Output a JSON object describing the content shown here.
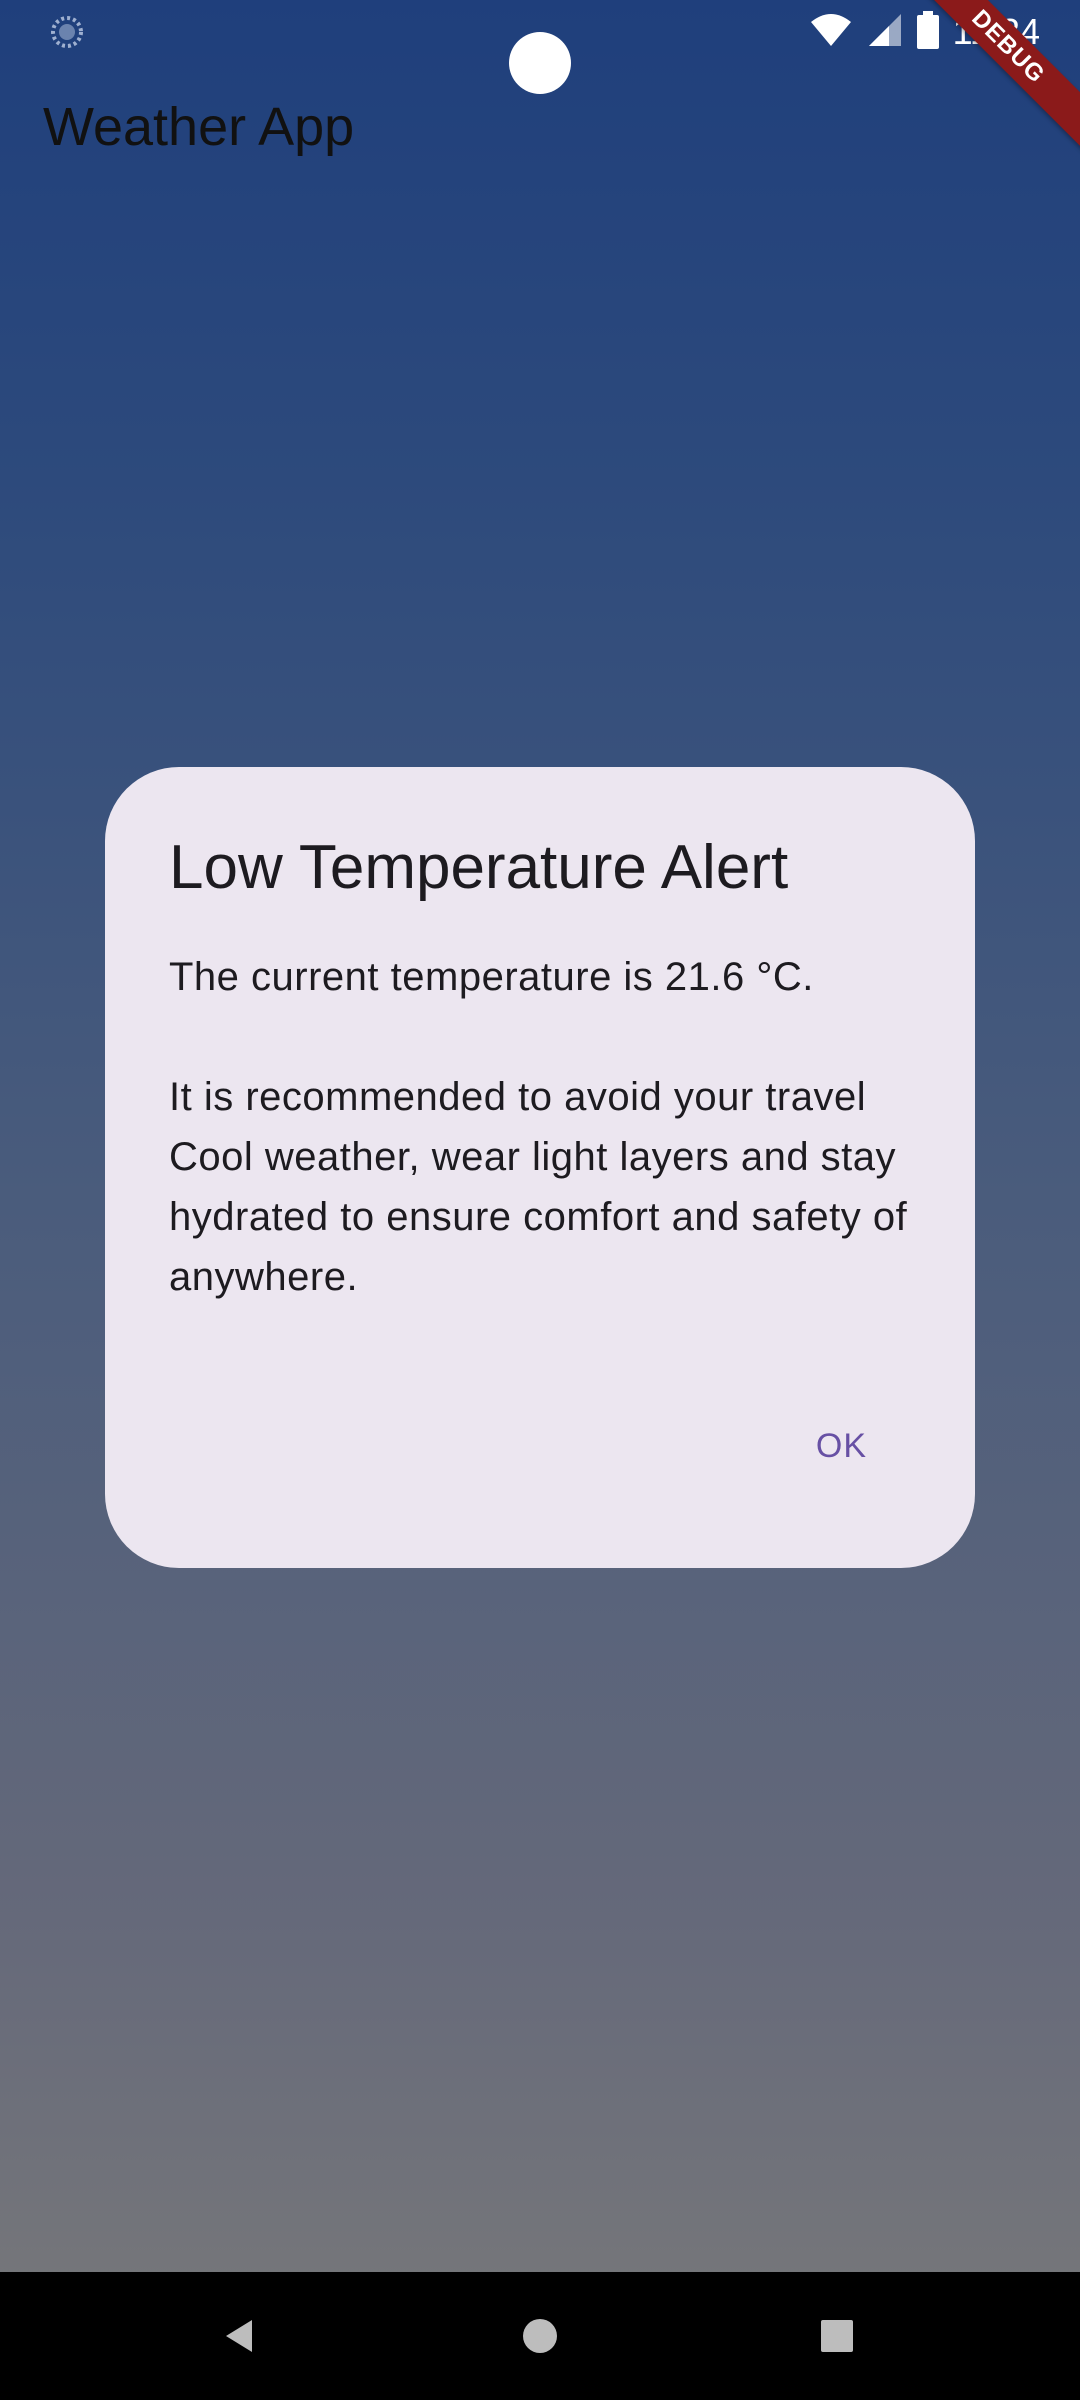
{
  "status_bar": {
    "time": "11:34",
    "left_icon": "loading-spinner-icon",
    "icons": [
      "wifi-icon",
      "signal-icon",
      "battery-icon"
    ]
  },
  "debug_banner": {
    "label": "DEBUG"
  },
  "app_bar": {
    "title": "Weather App"
  },
  "dialog": {
    "title": "Low Temperature Alert",
    "message_line1": "The current temperature is 21.6 °C.",
    "message_line2": "It is recommended to avoid your travel Cool weather, wear light layers and stay hydrated to ensure comfort and safety of anywhere.",
    "ok_label": "OK"
  },
  "nav_bar": {
    "buttons": [
      "back-icon",
      "home-icon",
      "recents-icon"
    ]
  },
  "colors": {
    "dialog_bg": "#ece6f0",
    "accent": "#6750a4",
    "debug_ribbon": "#8b1a1a"
  }
}
